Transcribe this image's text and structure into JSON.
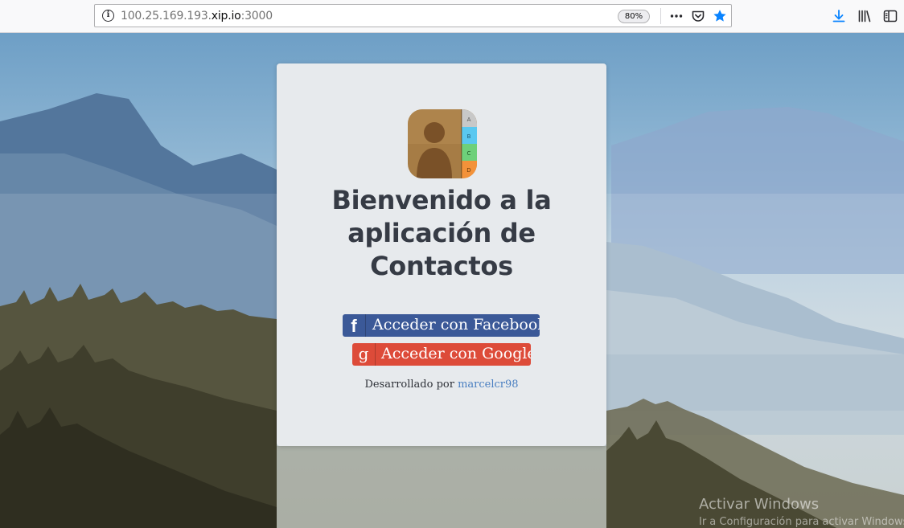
{
  "browser": {
    "url_prefix": "100.25.169.193.",
    "url_domain": "xip.io",
    "url_suffix": ":3000",
    "zoom": "80%"
  },
  "card": {
    "title": "Bienvenido a la aplicación de Contactos",
    "facebook_button": "Acceder con Facebook",
    "google_button": "Acceder con Google",
    "credit_prefix": "Desarrollado por",
    "credit_author": "marcelcr98",
    "app_icon_tabs": [
      "A",
      "B",
      "C",
      "D"
    ]
  },
  "watermark": {
    "title": "Activar Windows",
    "subtitle": "Ir a Configuración para activar Windows."
  },
  "colors": {
    "facebook": "#3b5998",
    "google": "#dd4b39",
    "link": "#4a7fc1",
    "star_accent": "#0a84ff"
  },
  "icons": [
    "info-icon",
    "more-actions-icon",
    "pocket-icon",
    "bookmark-star-icon",
    "download-icon",
    "library-icon",
    "sidebar-icon",
    "facebook-icon",
    "google-icon",
    "contacts-app-icon"
  ]
}
